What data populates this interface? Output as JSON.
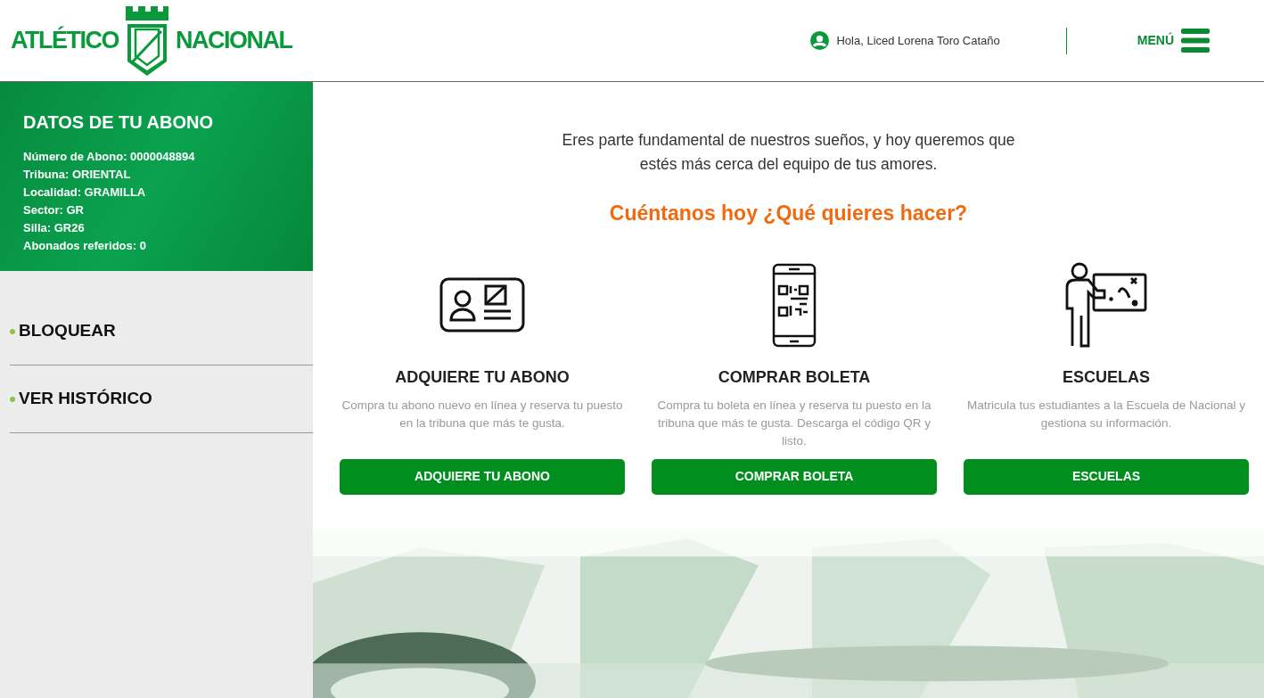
{
  "header": {
    "brand_left": "ATLÉTICO",
    "brand_right": "NACIONAL",
    "greeting": "Hola, Liced Lorena Toro Cataño",
    "menu_label": "MENÚ"
  },
  "sidebar": {
    "title": "DATOS DE TU ABONO",
    "details": [
      "Número de Abono: 0000048894",
      "Tribuna: ORIENTAL",
      "Localidad: GRAMILLA",
      "Sector: GR",
      "Silla: GR26",
      "Abonados referidos: 0"
    ],
    "actions": [
      "BLOQUEAR",
      "VER HISTÓRICO"
    ]
  },
  "main": {
    "intro": "Eres parte fundamental de nuestros sueños, y hoy queremos que estés más cerca del equipo de tus amores.",
    "question": "Cuéntanos hoy ¿Qué quieres hacer?",
    "options": [
      {
        "kind": "card",
        "title": "ADQUIERE TU ABONO",
        "description": "Compra tu abono nuevo en línea y reserva tu puesto en la tribuna que más te gusta.",
        "button": "ADQUIERE TU ABONO"
      },
      {
        "kind": "phone",
        "title": "COMPRAR BOLETA",
        "description": "Compra tu boleta en línea y reserva tu puesto en la tribuna que más te gusta. Descarga el código QR y listo.",
        "button": "COMPRAR BOLETA"
      },
      {
        "kind": "teacher",
        "title": "ESCUELAS",
        "description": "Matricula tus estudiantes a la Escuela de Nacional y gestiona su información.",
        "button": "ESCUELAS"
      }
    ]
  }
}
